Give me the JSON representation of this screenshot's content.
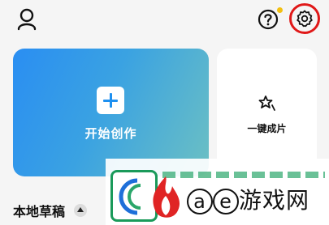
{
  "topbar": {
    "icons": [
      "profile-icon",
      "help-icon",
      "settings-icon"
    ],
    "notification_dot_color": "#f2c012",
    "settings_highlight_color": "#e01818"
  },
  "cards": {
    "start": {
      "label": "开始创作",
      "icon": "plus-icon"
    },
    "oneclick": {
      "label": "一键成片",
      "icon": "sparkle-star-icon"
    }
  },
  "drafts": {
    "title": "本地草稿",
    "icon": "sort-up-icon"
  },
  "watermark": {
    "text_a": "a",
    "text_e": "e",
    "text_cn": "游戏网"
  },
  "colors": {
    "accent_blue": "#2a8ef2",
    "card_bg": "#ffffff",
    "page_bg": "#f5f5f5"
  }
}
